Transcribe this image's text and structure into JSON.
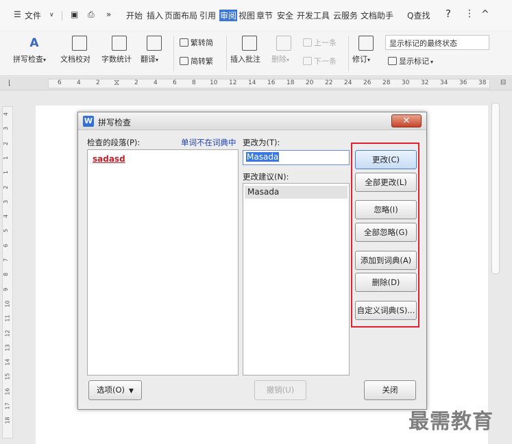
{
  "menubar": {
    "menu_label": "文件",
    "more": "»",
    "tabs": [
      "开始",
      "插入",
      "页面布局",
      "引用",
      "审阅",
      "视图",
      "章节",
      "安全",
      "开发工具",
      "云服务",
      "文档助手"
    ],
    "active_tab": "审阅",
    "search": "Q查找",
    "help": "?",
    "more_vert": "⋮",
    "collapse": "^"
  },
  "ribbon": {
    "spell_check": "拼写检查",
    "doc_proof": "文档校对",
    "word_count": "字数统计",
    "translate": "翻译",
    "trad_to_simp": "繁转简",
    "simp_to_trad": "简转繁",
    "insert_comment": "插入批注",
    "delete": "删除",
    "prev_item": "上一条",
    "next_item": "下一条",
    "revise": "修订",
    "markup_state": "显示标记的最终状态",
    "show_markup": "显示标记",
    "dropdown_mark": "▾"
  },
  "ruler": {
    "h_numbers": [
      "6",
      "4",
      "2",
      "2",
      "4",
      "6",
      "8",
      "10",
      "12",
      "14",
      "16",
      "18",
      "20",
      "22",
      "24",
      "26",
      "28",
      "30",
      "32",
      "34",
      "36",
      "38"
    ],
    "v_numbers": [
      "4",
      "3",
      "2",
      "1",
      "1",
      "2",
      "3",
      "4",
      "5",
      "6",
      "7",
      "8",
      "9",
      "10",
      "11",
      "12",
      "13",
      "14",
      "15",
      "16",
      "17",
      "18"
    ]
  },
  "dialog": {
    "title": "拼写检查",
    "close_glyph": "✕",
    "checked_paragraph_label": "检查的段落(P):",
    "not_in_dictionary": "单词不在词典中",
    "misspelled_word": "sadasd",
    "change_to_label": "更改为(T):",
    "change_to_value": "Masada",
    "suggestions_label": "更改建议(N):",
    "suggestions": [
      "Masada"
    ],
    "buttons": {
      "change": "更改(C)",
      "change_all": "全部更改(L)",
      "ignore": "忽略(I)",
      "ignore_all": "全部忽略(G)",
      "add_to_dictionary": "添加到词典(A)",
      "delete": "删除(D)",
      "custom_dictionary": "自定义词典(S)...",
      "options": "选项(O)",
      "undo": "撤销(U)",
      "close": "关闭"
    },
    "highlight_color": "#e02030"
  },
  "watermark": "最需教育"
}
